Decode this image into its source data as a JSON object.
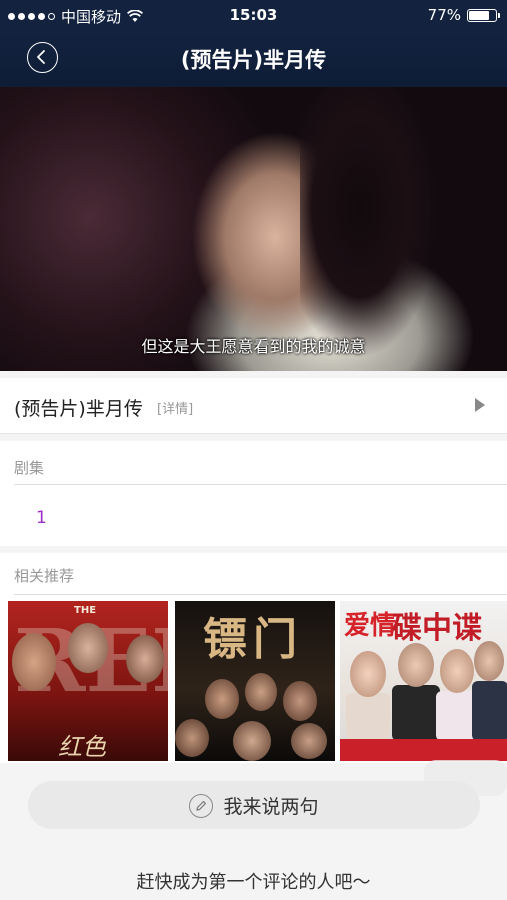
{
  "status_bar": {
    "carrier": "中国移动",
    "time": "15:03",
    "battery": "77%",
    "battery_level": 0.77
  },
  "nav": {
    "title": "(预告片)芈月传"
  },
  "video": {
    "subtitle": "但这是大王愿意看到的我的诚意"
  },
  "info": {
    "title": "(预告片)芈月传",
    "details_link": "[详情]"
  },
  "episodes": {
    "label": "剧集",
    "items": [
      "1"
    ]
  },
  "related": {
    "label": "相关推荐",
    "posters": [
      {
        "name": "红色",
        "top_text": "THE",
        "big_text": "RED",
        "calligraphy": "红色"
      },
      {
        "name": "镖门",
        "calligraphy": "镖门"
      },
      {
        "name": "爱情碟中谍",
        "t1": "爱情",
        "t2": "碟中谍"
      }
    ]
  },
  "comment": {
    "placeholder": "我来说两句",
    "empty_hint": "赶快成为第一个评论的人吧～"
  },
  "icons": {
    "back": "back-chevron-icon",
    "wifi": "wifi-icon",
    "battery": "battery-icon",
    "play": "play-arrow-icon",
    "pencil": "pencil-icon"
  },
  "colors": {
    "nav_bg": "#13233f",
    "episode_accent": "#9b2fc9"
  }
}
